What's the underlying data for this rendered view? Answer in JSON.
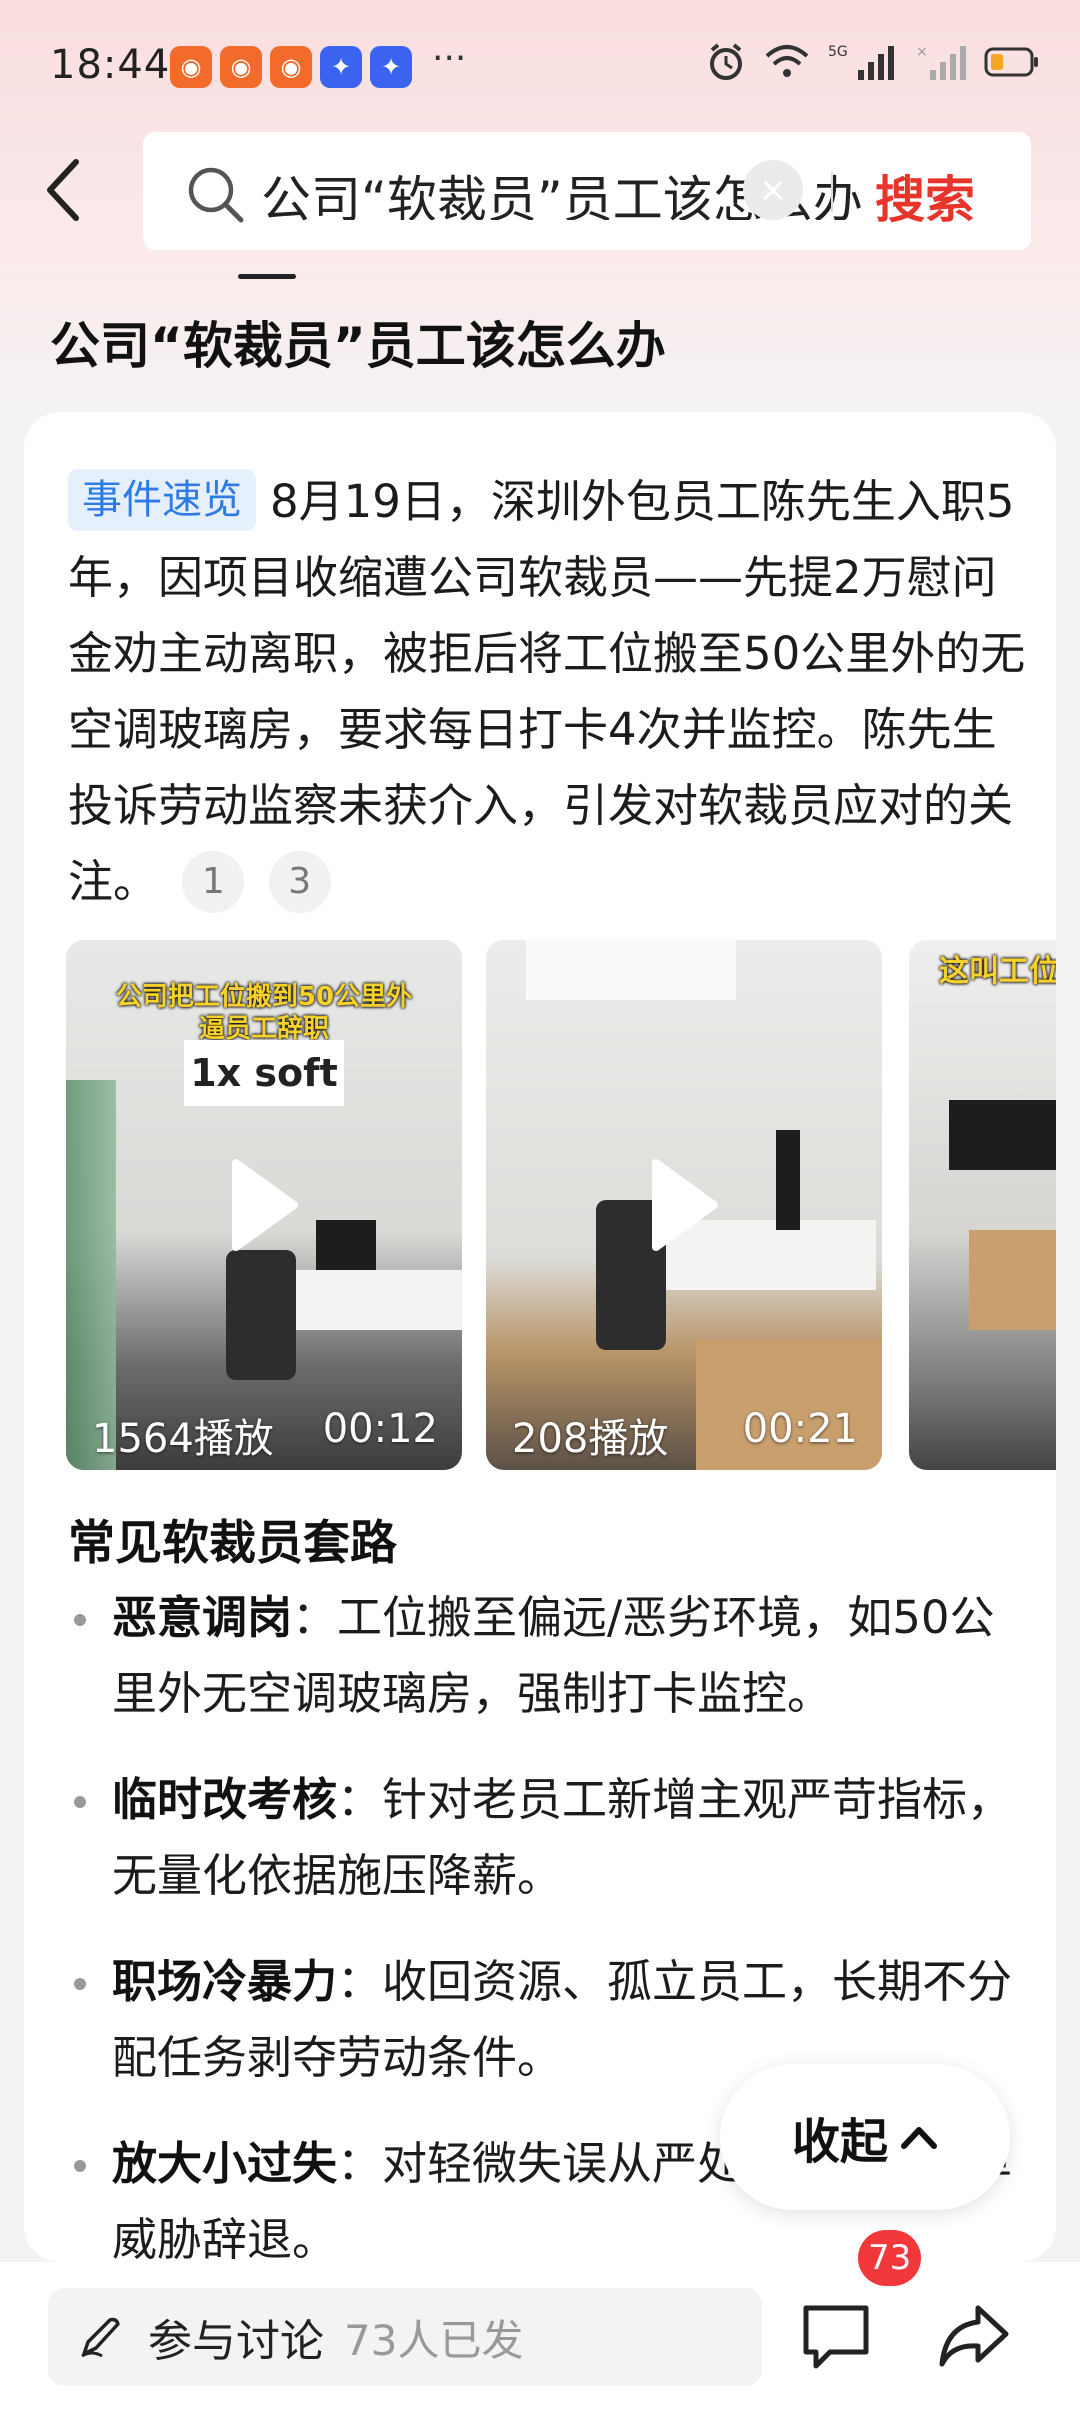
{
  "status_bar": {
    "time": "18:44",
    "more": "···",
    "network": "5G"
  },
  "search": {
    "query": "公司“软裁员”员工该怎么办",
    "clear_symbol": "×",
    "submit_label": "搜索"
  },
  "result": {
    "title": "公司“软裁员”员工该怎么办",
    "summary_tag": "事件速览",
    "summary_text": "8月19日，深圳外包员工陈先生入职5年，因项目收缩遭公司软裁员——先提2万慰问金劝主动离职，被拒后将工位搬至50公里外的无空调玻璃房，要求每日打卡4次并监控。陈先生投诉劳动监察未获介入，引发对软裁员应对的关注。",
    "citations": [
      "1",
      "3"
    ],
    "videos": [
      {
        "overlay_line1": "公司把工位搬到50公里外",
        "overlay_line2": "逼员工辞职",
        "logo": "1x soft",
        "views": "1564播放",
        "duration": "00:12"
      },
      {
        "overlay_line1": "",
        "overlay_line2": "",
        "logo": "",
        "views": "208播放",
        "duration": "00:21"
      },
      {
        "overlay_line1": "这叫工位",
        "overlay_line2": "",
        "logo": "",
        "views": "",
        "duration": ""
      }
    ],
    "section_title": "常见软裁员套路",
    "bullets": [
      {
        "term": "恶意调岗",
        "sep": "：",
        "desc": "工位搬至偏远/恶劣环境，如50公里外无空调玻璃房，强制打卡监控。"
      },
      {
        "term": "临时改考核",
        "sep": "：",
        "desc": "针对老员工新增主观严苛指标，无量化依据施压降薪。"
      },
      {
        "term": "职场冷暴力",
        "sep": "：",
        "desc": "收回资源、孤立员工，长期不分配任务剥夺劳动条件。"
      },
      {
        "term": "放大小过失",
        "sep": "：",
        "desc": "对轻微失误从严处理，开违纪单威胁辞退。"
      }
    ],
    "collapse_label": "收起"
  },
  "bottom_bar": {
    "discuss_label": "参与讨论",
    "discuss_count": "73人已发",
    "comment_badge": "73"
  },
  "colors": {
    "accent_red": "#e8352c",
    "tag_blue": "#2f7be5",
    "badge_red": "#f2383a"
  }
}
